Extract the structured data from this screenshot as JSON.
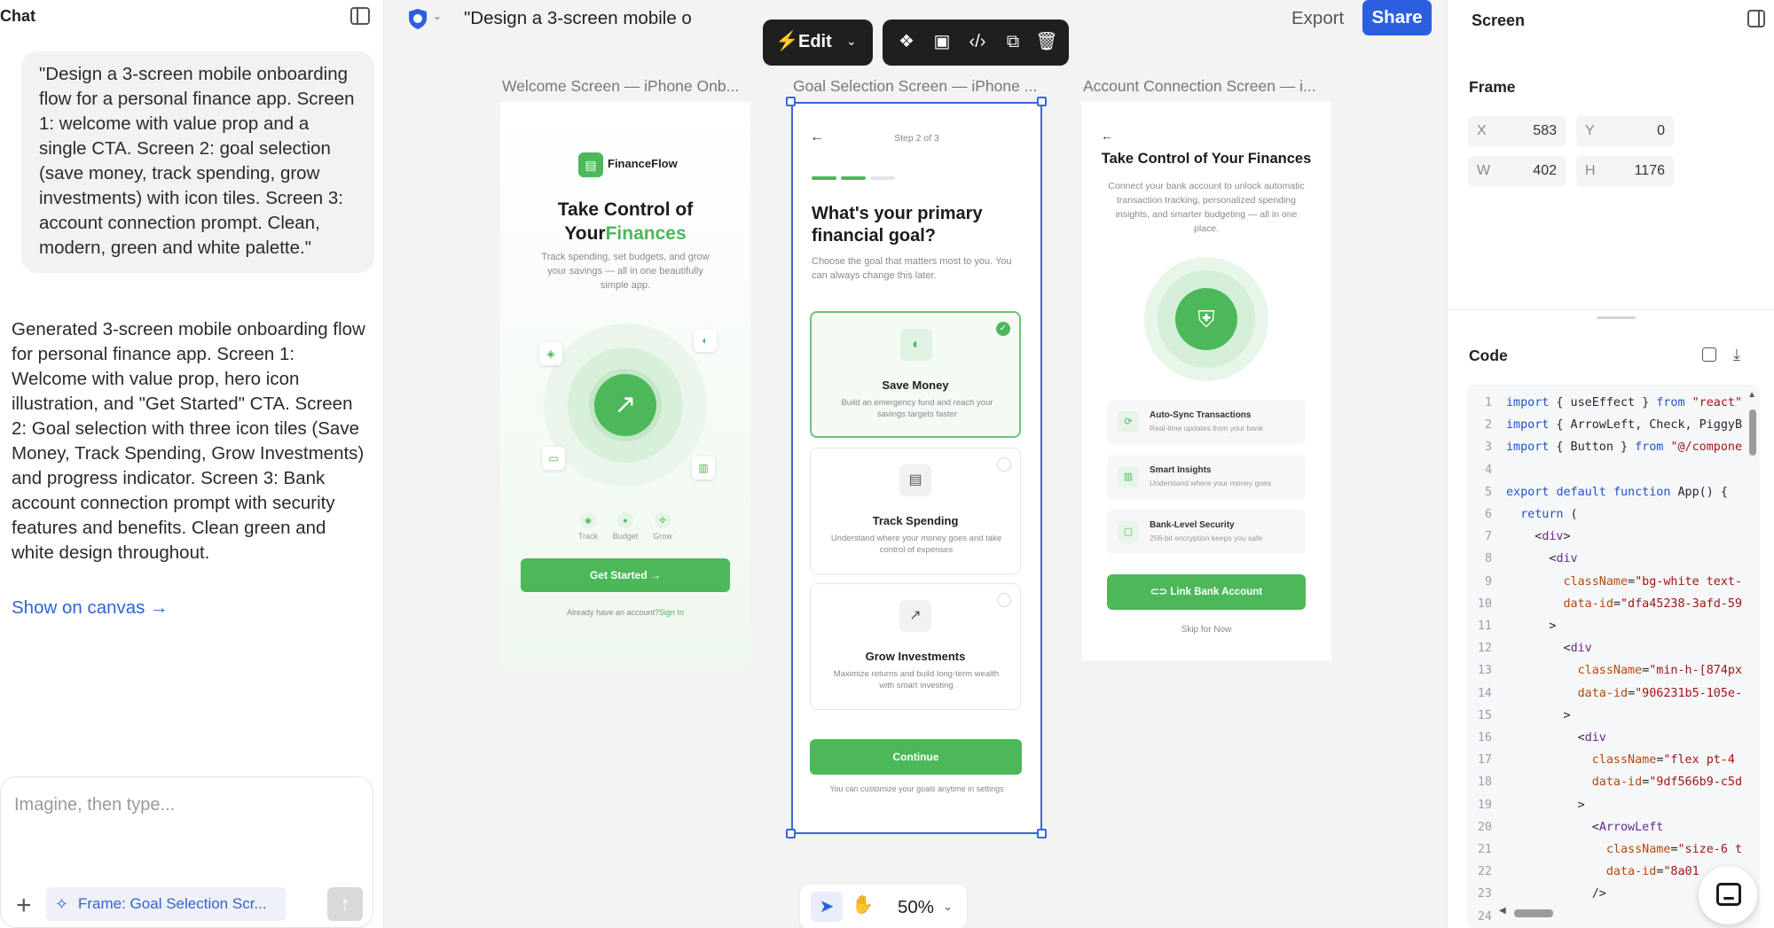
{
  "chat": {
    "title": "Chat",
    "prompt": "\"Design a 3-screen mobile onboarding flow for a personal finance app. Screen 1: welcome with value prop and a single CTA. Screen 2: goal selection (save money, track spending, grow investments) with icon tiles. Screen 3: account connection prompt. Clean, modern, green and white palette.\"",
    "reply": "Generated 3-screen mobile onboarding flow for personal finance app. Screen 1: Welcome with value prop, hero icon illustration, and \"Get Started\" CTA. Screen 2: Goal selection with three icon tiles (Save Money, Track Spending, Grow Investments) and progress indicator. Screen 3: Bank account connection prompt with security features and benefits. Clean green and white design throughout.",
    "show_on_canvas": "Show on canvas →",
    "composer_placeholder": "Imagine, then type...",
    "frame_chip": "Frame: Goal Selection Scr..."
  },
  "topbar": {
    "title": "\"Design a 3-screen mobile o",
    "edit_label": "Edit",
    "export_label": "Export",
    "share_label": "Share"
  },
  "frames": [
    {
      "label": "Welcome Screen — iPhone Onb..."
    },
    {
      "label": "Goal Selection Screen — iPhone ..."
    },
    {
      "label": "Account Connection Screen — i..."
    }
  ],
  "welcome": {
    "brand": "FinanceFlow",
    "headline_line1": "Take Control of",
    "headline_line2_a": "Your",
    "headline_line2_b": "Finances",
    "subtitle": "Track spending, set budgets, and grow your savings — all in one beautifully simple app.",
    "features": [
      "Track",
      "Budget",
      "Grow"
    ],
    "cta": "Get Started",
    "signin_prompt": "Already have an account?",
    "signin_link": "Sign In"
  },
  "goal": {
    "step": "Step 2 of 3",
    "question": "What's your primary financial goal?",
    "subtitle": "Choose the goal that matters most to you. You can always change this later.",
    "options": [
      {
        "title": "Save Money",
        "desc": "Build an emergency fund and reach your savings targets faster",
        "icon": "piggy-bank-icon"
      },
      {
        "title": "Track Spending",
        "desc": "Understand where your money goes and take control of expenses",
        "icon": "wallet-icon"
      },
      {
        "title": "Grow Investments",
        "desc": "Maximize returns and build long-term wealth with smart investing",
        "icon": "trending-up-icon"
      }
    ],
    "continue": "Continue",
    "footer": "You can customize your goals anytime in settings"
  },
  "account": {
    "title": "Take Control of Your Finances",
    "subtitle": "Connect your bank account to unlock automatic transaction tracking, personalized spending insights, and smarter budgeting — all in one place.",
    "features": [
      {
        "title": "Auto-Sync Transactions",
        "desc": "Real-time updates from your bank"
      },
      {
        "title": "Smart Insights",
        "desc": "Understand where your money goes"
      },
      {
        "title": "Bank-Level Security",
        "desc": "256-bit encryption keeps you safe"
      }
    ],
    "link_button": "Link Bank Account",
    "skip": "Skip for Now"
  },
  "toolbar": {
    "zoom": "50%"
  },
  "panel": {
    "title": "Screen",
    "frame_section": "Frame",
    "x_label": "X",
    "x": "583",
    "y_label": "Y",
    "y": "0",
    "w_label": "W",
    "w": "402",
    "h_label": "H",
    "h": "1176",
    "code_section": "Code"
  },
  "code_lines": [
    "import { useEffect } from \"react\"",
    "import { ArrowLeft, Check, PiggyB",
    "import { Button } from \"@/compone",
    "",
    "export default function App() {",
    "  return (",
    "    <div>",
    "      <div",
    "        className=\"bg-white text-",
    "        data-id=\"dfa45238-3afd-59",
    "      >",
    "        <div",
    "          className=\"min-h-[874px",
    "          data-id=\"906231b5-105e-",
    "        >",
    "          <div",
    "            className=\"flex pt-4",
    "            data-id=\"9df566b9-c5d",
    "          >",
    "            <ArrowLeft",
    "              className=\"size-6 t",
    "              data-id=\"8a01",
    "            />",
    ""
  ],
  "colors": {
    "accent_green": "#4cb85a",
    "brand_blue": "#2c5fe0",
    "toolbar_dark": "#1f1f1f"
  }
}
